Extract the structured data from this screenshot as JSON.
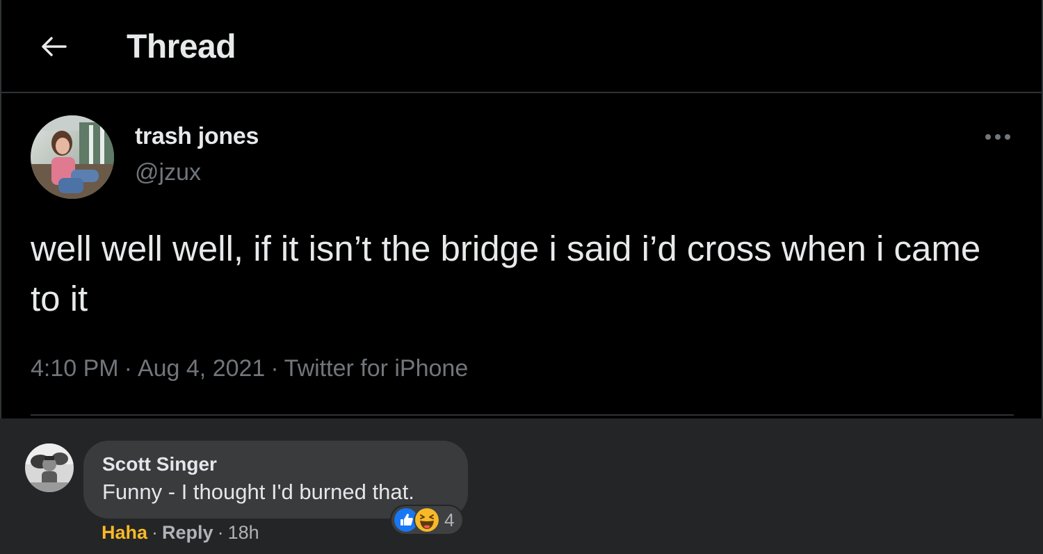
{
  "header": {
    "title": "Thread",
    "back_icon": "arrow-left-icon"
  },
  "tweet": {
    "display_name": "trash jones",
    "handle": "@jzux",
    "text": "well well well, if it isn’t the bridge i said i’d cross when i came to it",
    "time": "4:10 PM",
    "date": "Aug 4, 2021",
    "source": "Twitter for iPhone",
    "separator": "·",
    "more_icon": "more-horizontal-icon"
  },
  "comment": {
    "author": "Scott Singer",
    "text": "Funny - I thought I'd burned that.",
    "reaction_icons": [
      "like-icon",
      "haha-icon"
    ],
    "reaction_count": "4",
    "actions": {
      "haha": "Haha",
      "reply": "Reply",
      "time": "18h",
      "separator": "·"
    }
  },
  "colors": {
    "twitter_bg": "#000000",
    "twitter_text": "#e7e9ea",
    "twitter_muted": "#71767b",
    "twitter_border": "#2f3336",
    "facebook_bg": "#242526",
    "facebook_bubble": "#3a3b3c",
    "facebook_text": "#e4e6eb",
    "facebook_muted": "#b0b3b8",
    "haha_accent": "#f7b928",
    "like_blue": "#1877f2"
  }
}
